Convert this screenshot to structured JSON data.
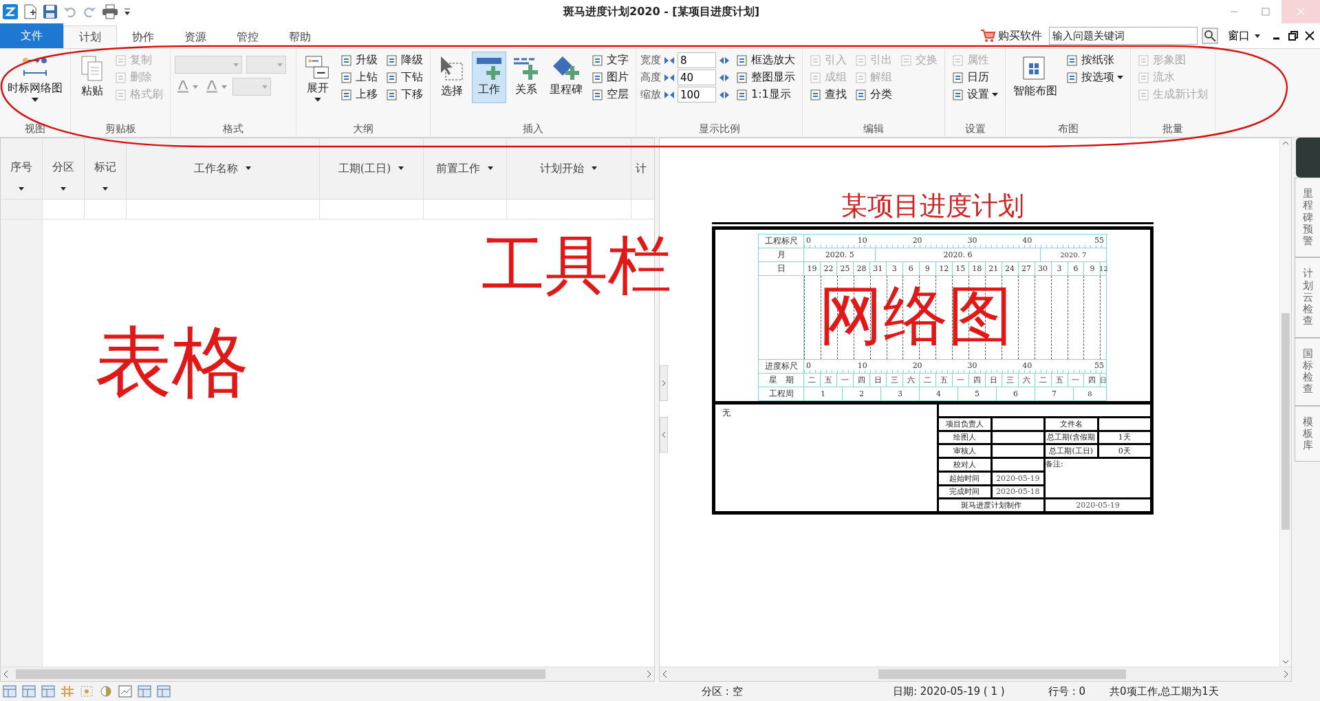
{
  "title_bar": {
    "title": "斑马进度计划2020 - [某项目进度计划]"
  },
  "menu_tabs": [
    {
      "label": "文件",
      "kind": "file",
      "selected": false
    },
    {
      "label": "计划",
      "kind": "tab",
      "selected": true
    },
    {
      "label": "协作",
      "kind": "tab",
      "selected": false
    },
    {
      "label": "资源",
      "kind": "tab",
      "selected": false
    },
    {
      "label": "管控",
      "kind": "tab",
      "selected": false
    },
    {
      "label": "帮助",
      "kind": "tab",
      "selected": false
    }
  ],
  "top_right": {
    "buy_label": "购买软件",
    "search_value": "输入问题关键词",
    "window_menu": "窗口"
  },
  "ribbon": {
    "groups": [
      {
        "label": "视图",
        "kind": "grid",
        "items": [
          {
            "kind": "large-menu",
            "label": "时标网络图",
            "disabled": false
          }
        ]
      },
      {
        "label": "剪贴板",
        "kind": "grid",
        "items": [
          {
            "kind": "large",
            "label": "粘贴",
            "disabled": false
          },
          {
            "kind": "small",
            "label": "复制",
            "disabled": true
          },
          {
            "kind": "small",
            "label": "删除",
            "disabled": true
          },
          {
            "kind": "small",
            "label": "格式刷",
            "disabled": true
          }
        ]
      },
      {
        "label": "格式",
        "kind": "wrap",
        "items": [
          {
            "kind": "combo",
            "disabled": true
          },
          {
            "kind": "combo",
            "disabled": true
          },
          {
            "kind": "color",
            "disabled": true
          },
          {
            "kind": "color",
            "disabled": true
          },
          {
            "kind": "combo",
            "disabled": true
          }
        ]
      },
      {
        "label": "大纲",
        "kind": "grid",
        "items": [
          {
            "kind": "large-menu",
            "label": "展开",
            "disabled": false
          },
          {
            "kind": "small",
            "label": "升级",
            "disabled": false
          },
          {
            "kind": "small",
            "label": "上钻",
            "disabled": false
          },
          {
            "kind": "small",
            "label": "上移",
            "disabled": false
          },
          {
            "kind": "small",
            "label": "降级",
            "disabled": false
          },
          {
            "kind": "small",
            "label": "下钻",
            "disabled": false
          },
          {
            "kind": "small",
            "label": "下移",
            "disabled": false
          }
        ]
      },
      {
        "label": "插入",
        "kind": "grid",
        "items": [
          {
            "kind": "large",
            "label": "选择",
            "disabled": false,
            "selected": false
          },
          {
            "kind": "large",
            "label": "工作",
            "disabled": false,
            "selected": true
          },
          {
            "kind": "large",
            "label": "关系",
            "disabled": false,
            "selected": false
          },
          {
            "kind": "large",
            "label": "里程碑",
            "disabled": false,
            "selected": false
          },
          {
            "kind": "small",
            "label": "文字",
            "disabled": false,
            "selected": false
          },
          {
            "kind": "small",
            "label": "图片",
            "disabled": false,
            "selected": false
          },
          {
            "kind": "small",
            "label": "空层",
            "disabled": false,
            "selected": false
          }
        ]
      },
      {
        "label": "显示比例",
        "kind": "grid",
        "items": [
          {
            "kind": "spin",
            "label": "宽度",
            "value": "8"
          },
          {
            "kind": "spin",
            "label": "高度",
            "value": "40"
          },
          {
            "kind": "spin",
            "label": "缩放",
            "value": "100"
          },
          {
            "kind": "small",
            "label": "框选放大",
            "disabled": false
          },
          {
            "kind": "small",
            "label": "整图显示",
            "disabled": false
          },
          {
            "kind": "small",
            "label": "1:1显示",
            "disabled": false
          }
        ]
      },
      {
        "label": "编辑",
        "kind": "grid",
        "items": [
          {
            "kind": "small",
            "label": "引入",
            "disabled": true
          },
          {
            "kind": "small",
            "label": "成组",
            "disabled": true
          },
          {
            "kind": "small",
            "label": "查找",
            "disabled": false
          },
          {
            "kind": "small",
            "label": "引出",
            "disabled": true
          },
          {
            "kind": "small",
            "label": "解组",
            "disabled": true
          },
          {
            "kind": "small",
            "label": "分类",
            "disabled": false
          },
          {
            "kind": "small",
            "label": "交换",
            "disabled": true
          }
        ]
      },
      {
        "label": "设置",
        "kind": "grid",
        "items": [
          {
            "kind": "small",
            "label": "属性",
            "disabled": true
          },
          {
            "kind": "small",
            "label": "日历",
            "disabled": false
          },
          {
            "kind": "small-menu",
            "label": "设置",
            "disabled": false
          }
        ]
      },
      {
        "label": "布图",
        "kind": "grid",
        "items": [
          {
            "kind": "large",
            "label": "智能布图",
            "disabled": false
          },
          {
            "kind": "small",
            "label": "按纸张",
            "disabled": false
          },
          {
            "kind": "small-menu",
            "label": "按选项",
            "disabled": false
          }
        ]
      },
      {
        "label": "批量",
        "kind": "grid",
        "items": [
          {
            "kind": "small",
            "label": "形象图",
            "disabled": true
          },
          {
            "kind": "small",
            "label": "流水",
            "disabled": true
          },
          {
            "kind": "small",
            "label": "生成新计划",
            "disabled": true
          }
        ]
      }
    ]
  },
  "table": {
    "columns": [
      "序号",
      "分区",
      "标记",
      "工作名称",
      "工期(工日)",
      "前置工作",
      "计划开始",
      "计"
    ]
  },
  "chart_doc": {
    "title": "某项目进度计划",
    "scale_label": "工程标尺",
    "scale_ticks": [
      "0",
      "10",
      "20",
      "30",
      "40",
      "55"
    ],
    "month_label": "月",
    "months": [
      "2020. 5",
      "2020. 6",
      "2020. 7"
    ],
    "day_label": "日",
    "days": [
      "19",
      "22",
      "25",
      "28",
      "31",
      "3",
      "6",
      "9",
      "12",
      "15",
      "18",
      "21",
      "24",
      "27",
      "30",
      "3",
      "6",
      "9",
      "12"
    ],
    "progress_label": "进度标尺",
    "progress_ticks": [
      "0",
      "10",
      "20",
      "30",
      "40",
      "55"
    ],
    "weekday_label": "星　期",
    "weekdays": [
      "二",
      "五",
      "一",
      "四",
      "日",
      "三",
      "六",
      "二",
      "五",
      "一",
      "四",
      "日",
      "三",
      "六",
      "二",
      "五",
      "一",
      "四",
      "日"
    ],
    "week_label": "工程周",
    "weeks": [
      "1",
      "2",
      "3",
      "4",
      "5",
      "6",
      "7",
      "8"
    ],
    "note": "无",
    "info_rows": [
      {
        "label": "项目负责人",
        "label2": "文件名"
      },
      {
        "label": "绘图人",
        "label2": "总工期(含假期",
        "value2": "1天"
      },
      {
        "label": "审核人",
        "label2": "总工期(工日)",
        "value2": "0天"
      },
      {
        "label": "校对人",
        "label2": "备注:"
      },
      {
        "label": "起始时间",
        "value": "2020-05-19"
      },
      {
        "label": "完成时间",
        "value": "2020-05-18"
      }
    ],
    "maker": {
      "label": "斑马进度计划制作",
      "value": "2020-05-19"
    }
  },
  "side_tabs": [
    "里程碑预警",
    "计划云检查",
    "国标检查",
    "模板库"
  ],
  "status_bar": {
    "partition": "分区 : 空",
    "date": "日期: 2020-05-19 ( 1 )",
    "row": "行号 : 0",
    "summary": "共0项工作,总工期为1天"
  },
  "annotations": [
    {
      "text": "工具栏"
    },
    {
      "text": "表格"
    },
    {
      "text": "网络图"
    }
  ]
}
